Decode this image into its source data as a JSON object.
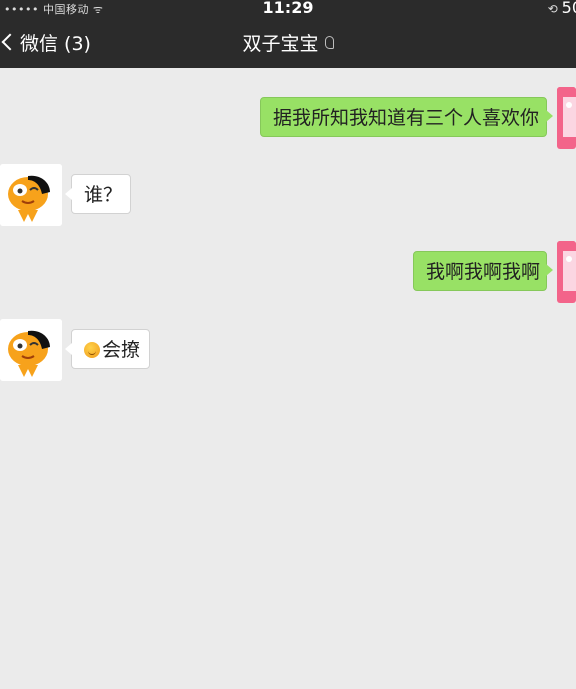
{
  "status_bar": {
    "carrier": "•••••  中国移动  ᯤ",
    "time": "11:29",
    "lock_icon": "rotation-lock-icon",
    "battery": "50"
  },
  "nav": {
    "back_label": "微信 (3)",
    "title": "双子宝宝",
    "title_icon": "earpiece-icon"
  },
  "messages": [
    {
      "direction": "outgoing",
      "text": "据我所知我知道有三个人喜欢你"
    },
    {
      "direction": "incoming",
      "text": "谁？"
    },
    {
      "direction": "outgoing",
      "text": "我啊我啊我啊"
    },
    {
      "direction": "incoming",
      "emoji": "smile-emoji",
      "text": "会撩"
    }
  ],
  "colors": {
    "header_bg": "#2b2b2b",
    "chat_bg": "#ebebeb",
    "outgoing_bubble": "#98e165",
    "incoming_bubble": "#ffffff"
  }
}
